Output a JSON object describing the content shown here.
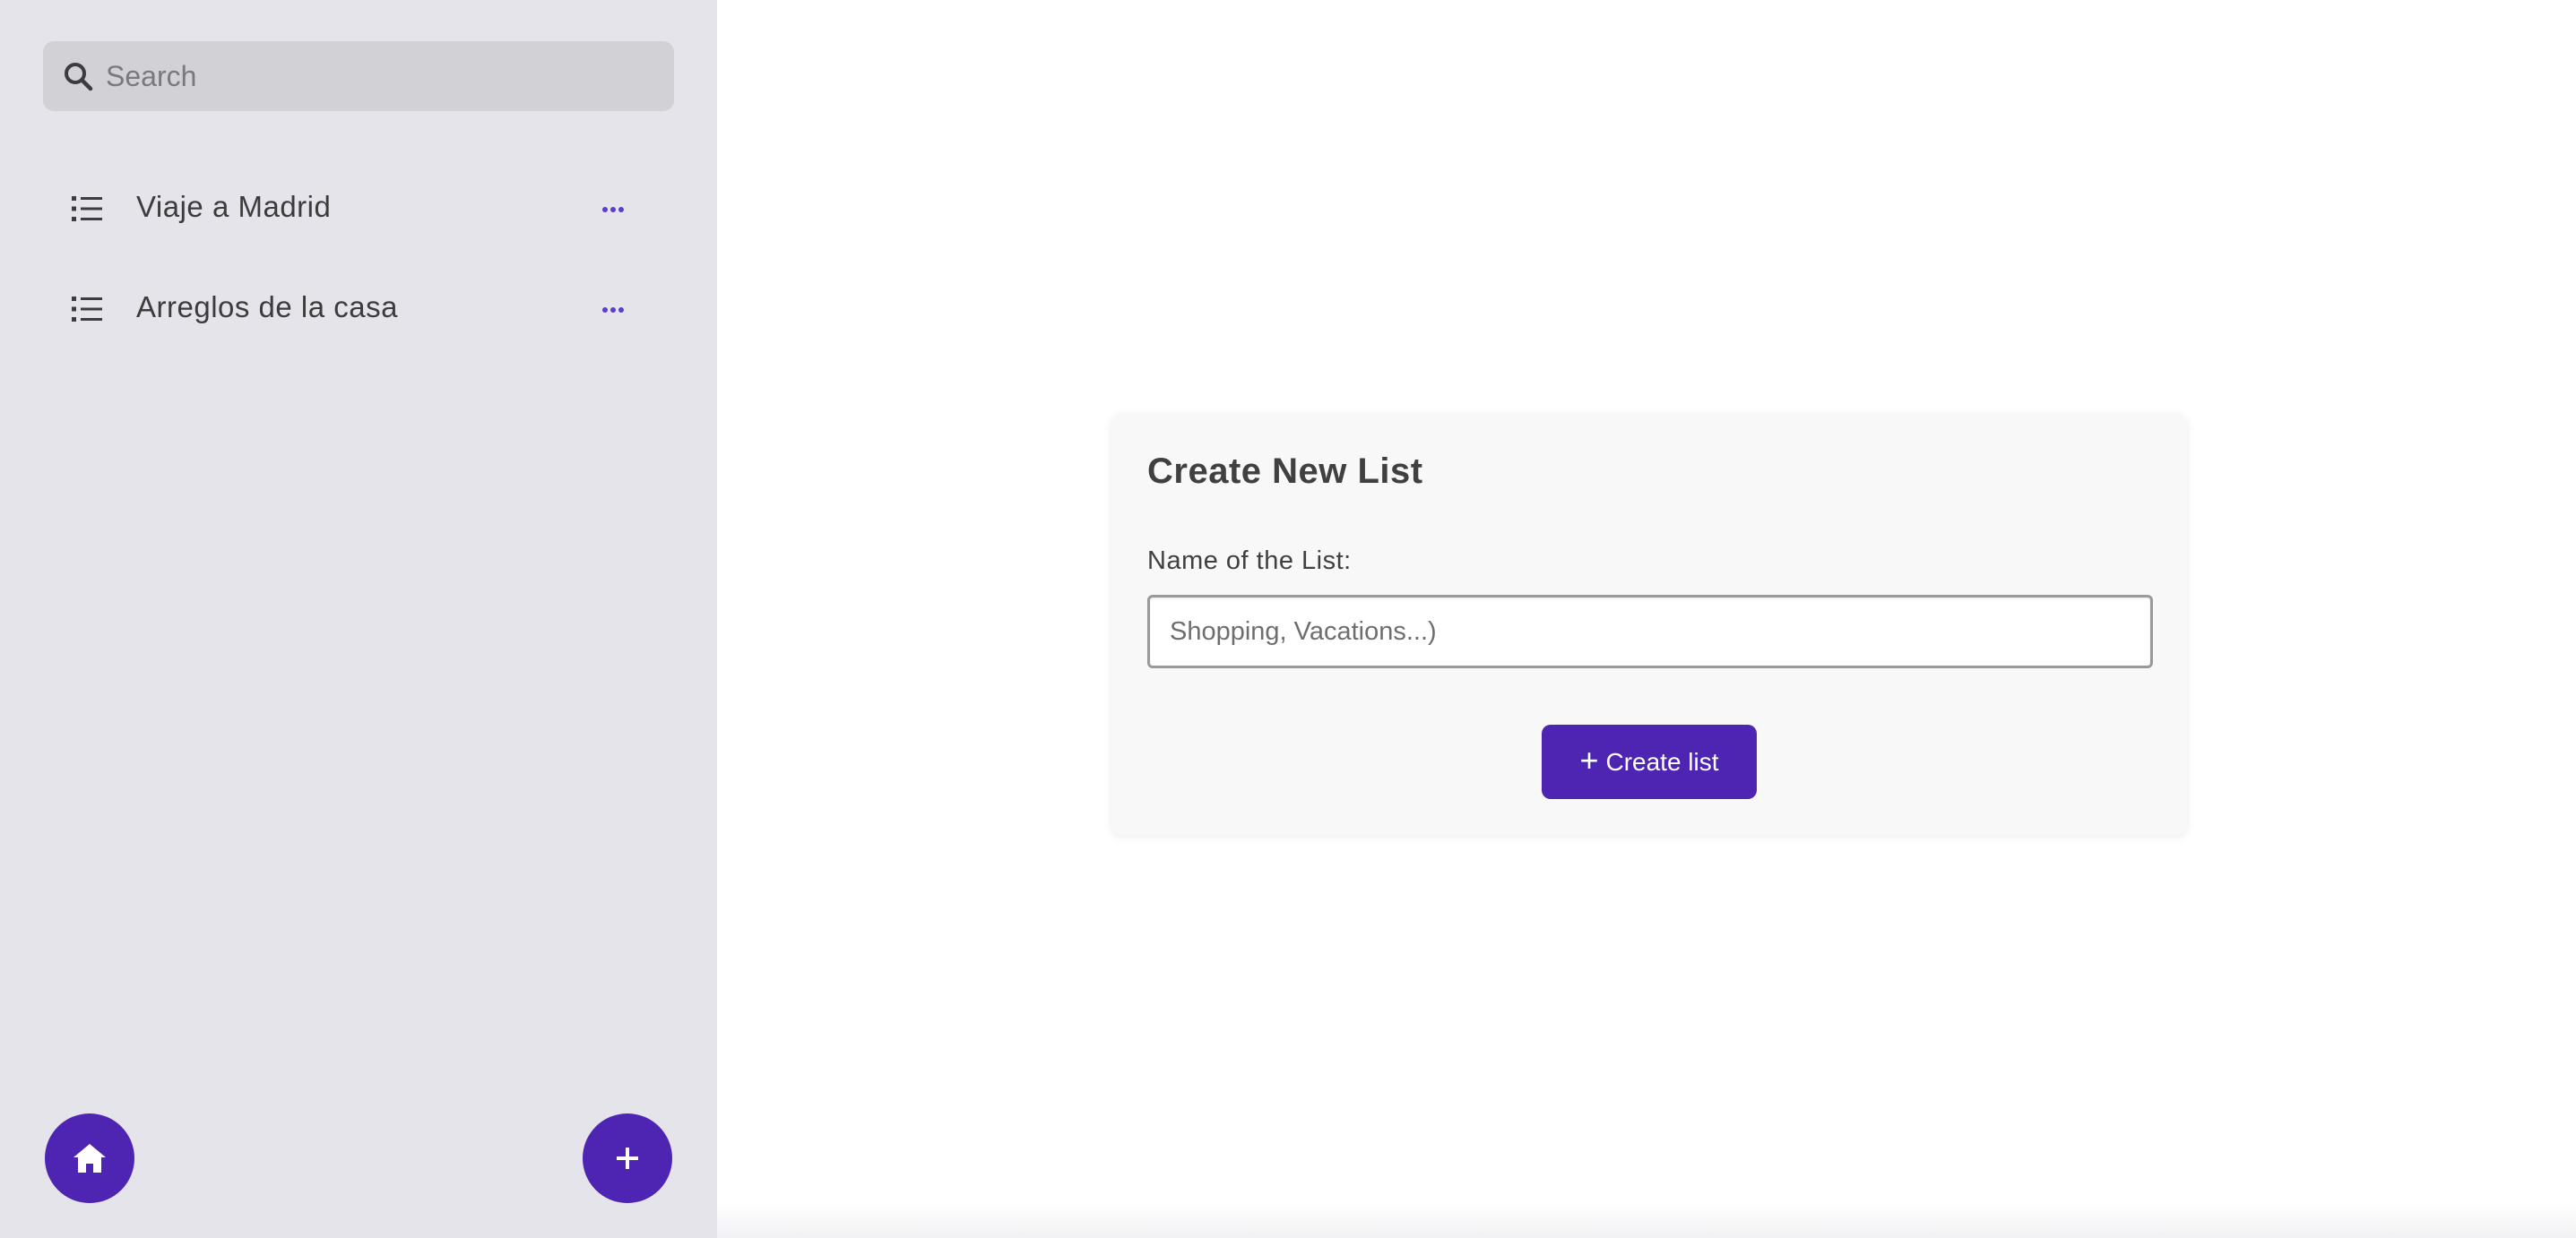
{
  "sidebar": {
    "search": {
      "placeholder": "Search",
      "icon": "search-icon"
    },
    "items": [
      {
        "label": "Viaje a Madrid",
        "icon": "list-icon",
        "menu_icon": "more-dots-icon"
      },
      {
        "label": "Arreglos de la casa",
        "icon": "list-icon",
        "menu_icon": "more-dots-icon"
      }
    ],
    "home_button": {
      "icon": "home-icon"
    },
    "add_button": {
      "icon": "plus-icon"
    }
  },
  "main": {
    "card": {
      "title": "Create New List",
      "field_label": "Name of the List:",
      "input_placeholder": "Shopping, Vacations...)",
      "input_value": "",
      "button_label": "Create list",
      "button_icon": "plus-icon"
    }
  },
  "colors": {
    "sidebar_bg": "#e5e4ea",
    "search_bg": "#d2d1d6",
    "accent": "#4e24b3",
    "accent_dots": "#5b3ccf",
    "card_bg": "#f8f8f8",
    "text": "#404040"
  }
}
